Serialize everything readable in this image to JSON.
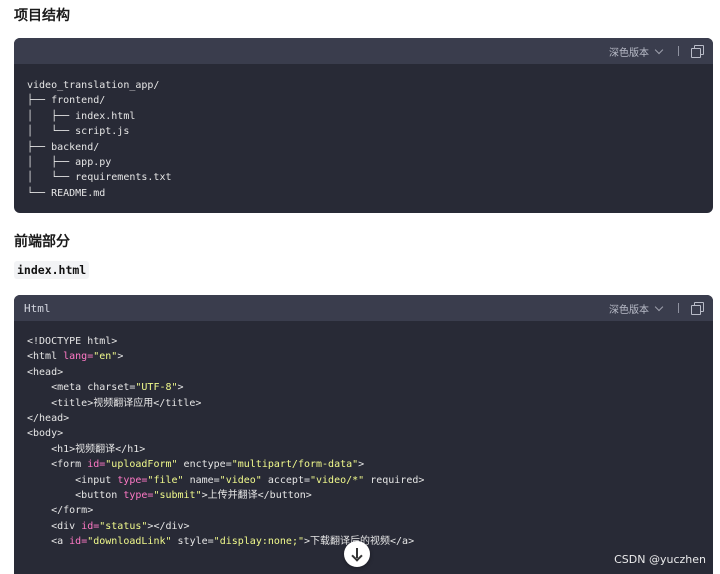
{
  "sections": {
    "structure_title": "项目结构",
    "frontend_title": "前端部分",
    "file_label": "index.html"
  },
  "code_block_1": {
    "theme_label": "深色版本",
    "lines": [
      "video_translation_app/",
      "├── frontend/",
      "│   ├── index.html",
      "│   └── script.js",
      "├── backend/",
      "│   ├── app.py",
      "│   └── requirements.txt",
      "└── README.md"
    ]
  },
  "code_block_2": {
    "language": "Html",
    "theme_label": "深色版本",
    "lines": [
      [
        {
          "t": "<!DOCTYPE html>",
          "c": "tag"
        }
      ],
      [
        {
          "t": "<html ",
          "c": "tag"
        },
        {
          "t": "lang=",
          "c": "attr"
        },
        {
          "t": "\"en\"",
          "c": "str"
        },
        {
          "t": ">",
          "c": "tag"
        }
      ],
      [
        {
          "t": "<head>",
          "c": "tag"
        }
      ],
      [
        {
          "t": "    <meta ",
          "c": "tag"
        },
        {
          "t": "charset=",
          "c": "tag"
        },
        {
          "t": "\"UTF-8\"",
          "c": "str"
        },
        {
          "t": ">",
          "c": "tag"
        }
      ],
      [
        {
          "t": "    <title>视频翻译应用</title>",
          "c": "tag"
        }
      ],
      [
        {
          "t": "</head>",
          "c": "tag"
        }
      ],
      [
        {
          "t": "<body>",
          "c": "tag"
        }
      ],
      [
        {
          "t": "    <h1>视频翻译</h1>",
          "c": "tag"
        }
      ],
      [
        {
          "t": "    <form ",
          "c": "tag"
        },
        {
          "t": "id=",
          "c": "attr"
        },
        {
          "t": "\"uploadForm\"",
          "c": "str"
        },
        {
          "t": " enctype=",
          "c": "tag"
        },
        {
          "t": "\"multipart/form-data\"",
          "c": "str"
        },
        {
          "t": ">",
          "c": "tag"
        }
      ],
      [
        {
          "t": "        <input ",
          "c": "tag"
        },
        {
          "t": "type=",
          "c": "attr"
        },
        {
          "t": "\"file\"",
          "c": "str"
        },
        {
          "t": " name=",
          "c": "tag"
        },
        {
          "t": "\"video\"",
          "c": "str"
        },
        {
          "t": " accept=",
          "c": "tag"
        },
        {
          "t": "\"video/*\"",
          "c": "str"
        },
        {
          "t": " required>",
          "c": "tag"
        }
      ],
      [
        {
          "t": "        <button ",
          "c": "tag"
        },
        {
          "t": "type=",
          "c": "attr"
        },
        {
          "t": "\"submit\"",
          "c": "str"
        },
        {
          "t": ">上传并翻译</button>",
          "c": "tag"
        }
      ],
      [
        {
          "t": "    </form>",
          "c": "tag"
        }
      ],
      [
        {
          "t": "    <div ",
          "c": "tag"
        },
        {
          "t": "id=",
          "c": "attr"
        },
        {
          "t": "\"status\"",
          "c": "str"
        },
        {
          "t": "></div>",
          "c": "tag"
        }
      ],
      [
        {
          "t": "    <a ",
          "c": "tag"
        },
        {
          "t": "id=",
          "c": "attr"
        },
        {
          "t": "\"downloadLink\"",
          "c": "str"
        },
        {
          "t": " style=",
          "c": "tag"
        },
        {
          "t": "\"display:none;\"",
          "c": "str"
        },
        {
          "t": ">下载翻译后的视频</a>",
          "c": "tag"
        }
      ]
    ]
  },
  "watermark": "CSDN @yuczhen",
  "icons": {
    "copy": "copy-icon",
    "theme_dropdown": "chevron-down-icon",
    "scroll": "arrow-down-icon"
  },
  "colors": {
    "code_bg": "#282a36",
    "header_bg": "#3a3d4d",
    "attr": "#ff79c6",
    "string": "#f1fa8c"
  }
}
